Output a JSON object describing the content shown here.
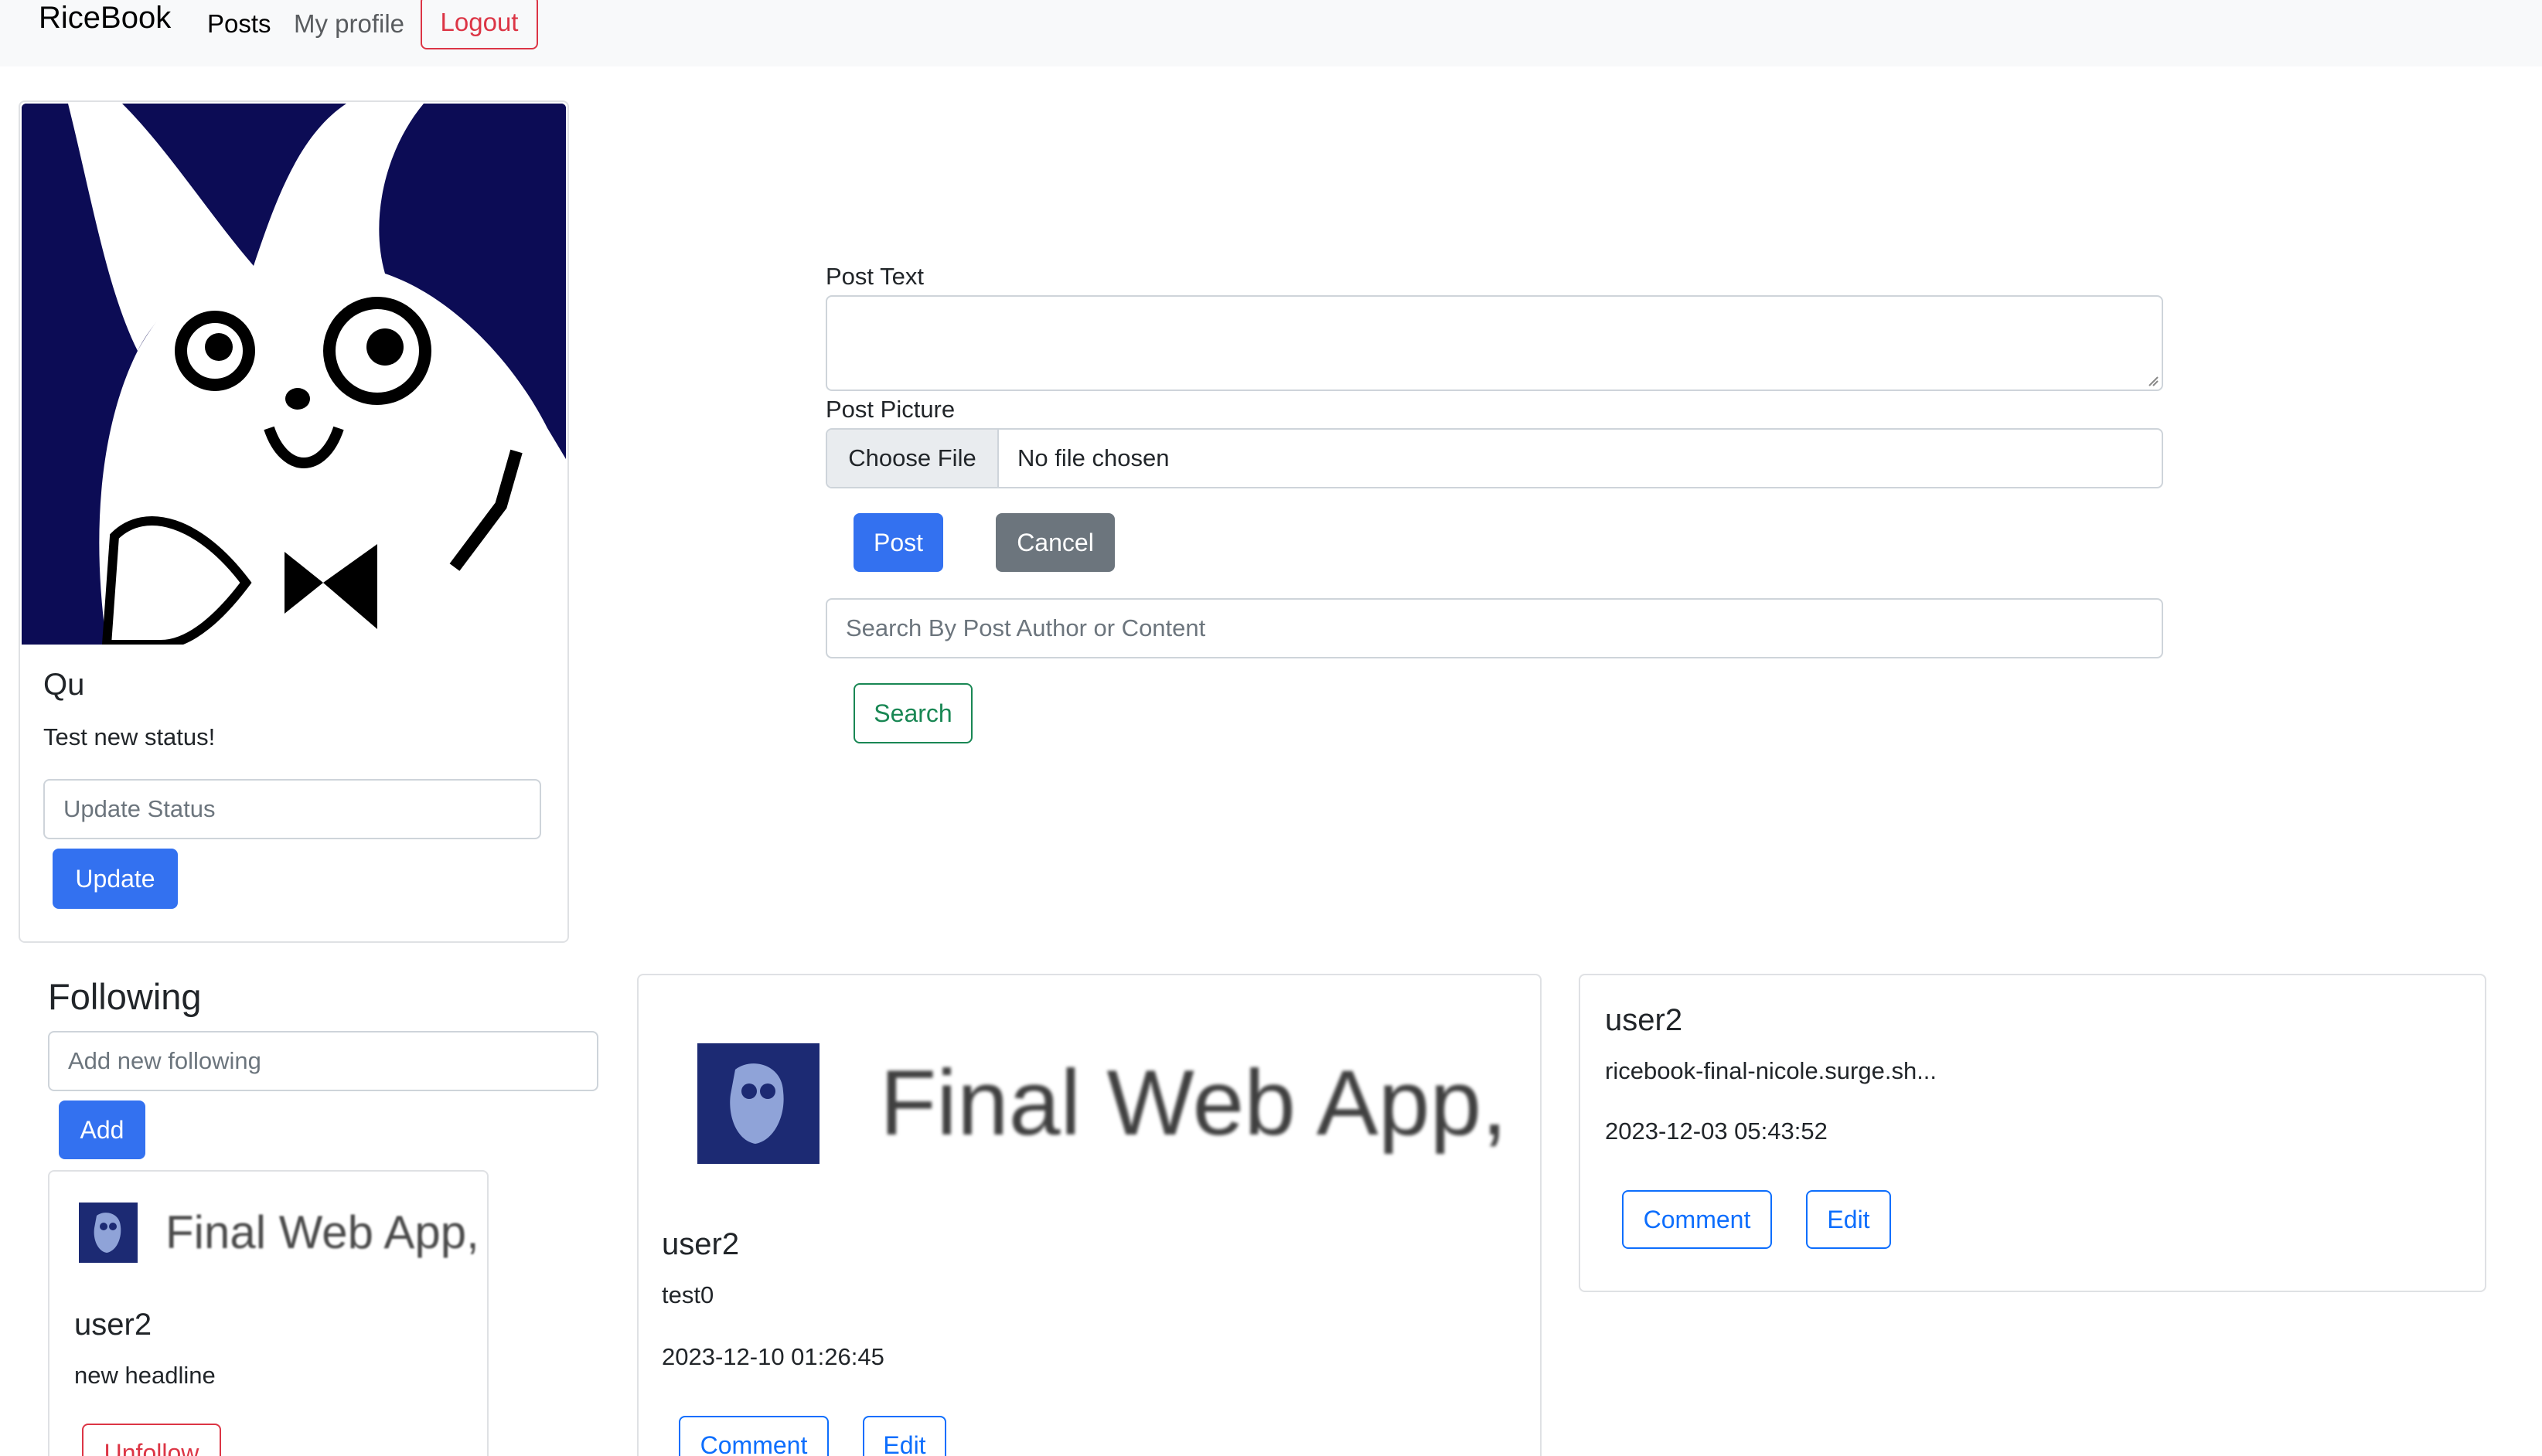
{
  "navbar": {
    "brand": "RiceBook",
    "links": [
      "Posts",
      "My profile"
    ],
    "logout": "Logout"
  },
  "profile": {
    "name": "Qu",
    "status": "Test new status!",
    "status_placeholder": "Update Status",
    "update_label": "Update"
  },
  "new_post": {
    "text_label": "Post Text",
    "picture_label": "Post Picture",
    "choose_file": "Choose File",
    "no_file": "No file chosen",
    "post_label": "Post",
    "cancel_label": "Cancel",
    "search_placeholder": "Search By Post Author or Content",
    "search_label": "Search"
  },
  "following": {
    "heading": "Following",
    "add_placeholder": "Add new following",
    "add_label": "Add",
    "items": [
      {
        "image_text": "Final Web App,",
        "name": "user2",
        "headline": "new headline",
        "unfollow_label": "Unfollow"
      }
    ]
  },
  "posts": [
    {
      "image_text": "Final Web App,",
      "author": "user2",
      "text": "test0",
      "timestamp": "2023-12-10 01:26:45",
      "comment_label": "Comment",
      "edit_label": "Edit"
    },
    {
      "author": "user2",
      "text": "ricebook-final-nicole.surge.sh...",
      "timestamp": "2023-12-03 05:43:52",
      "comment_label": "Comment",
      "edit_label": "Edit"
    }
  ],
  "colors": {
    "primary": "#3371f0",
    "danger": "#dc3545",
    "success": "#198754",
    "secondary": "#6c757d",
    "navbar_bg": "#f8f9fa"
  }
}
